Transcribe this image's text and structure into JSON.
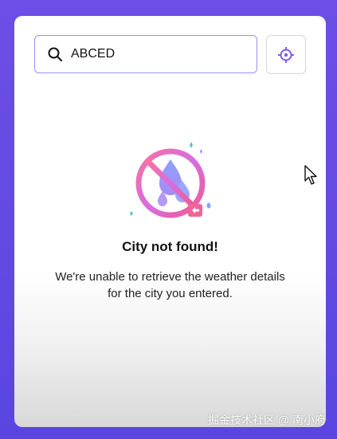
{
  "search": {
    "value": "ABCED",
    "icon": "search-icon"
  },
  "locate_button": {
    "icon": "location-crosshair-icon"
  },
  "empty_state": {
    "illustration": "city-not-found-icon",
    "title": "City not found!",
    "message": "We're unable to retrieve the weather details for the city you entered."
  },
  "watermark": "掘金技术社区 @ 南小府",
  "colors": {
    "background": "#6c4fe6",
    "input_border": "#9b90f5",
    "illustration_pink": "#f0649a",
    "illustration_blue": "#8f9bff"
  }
}
